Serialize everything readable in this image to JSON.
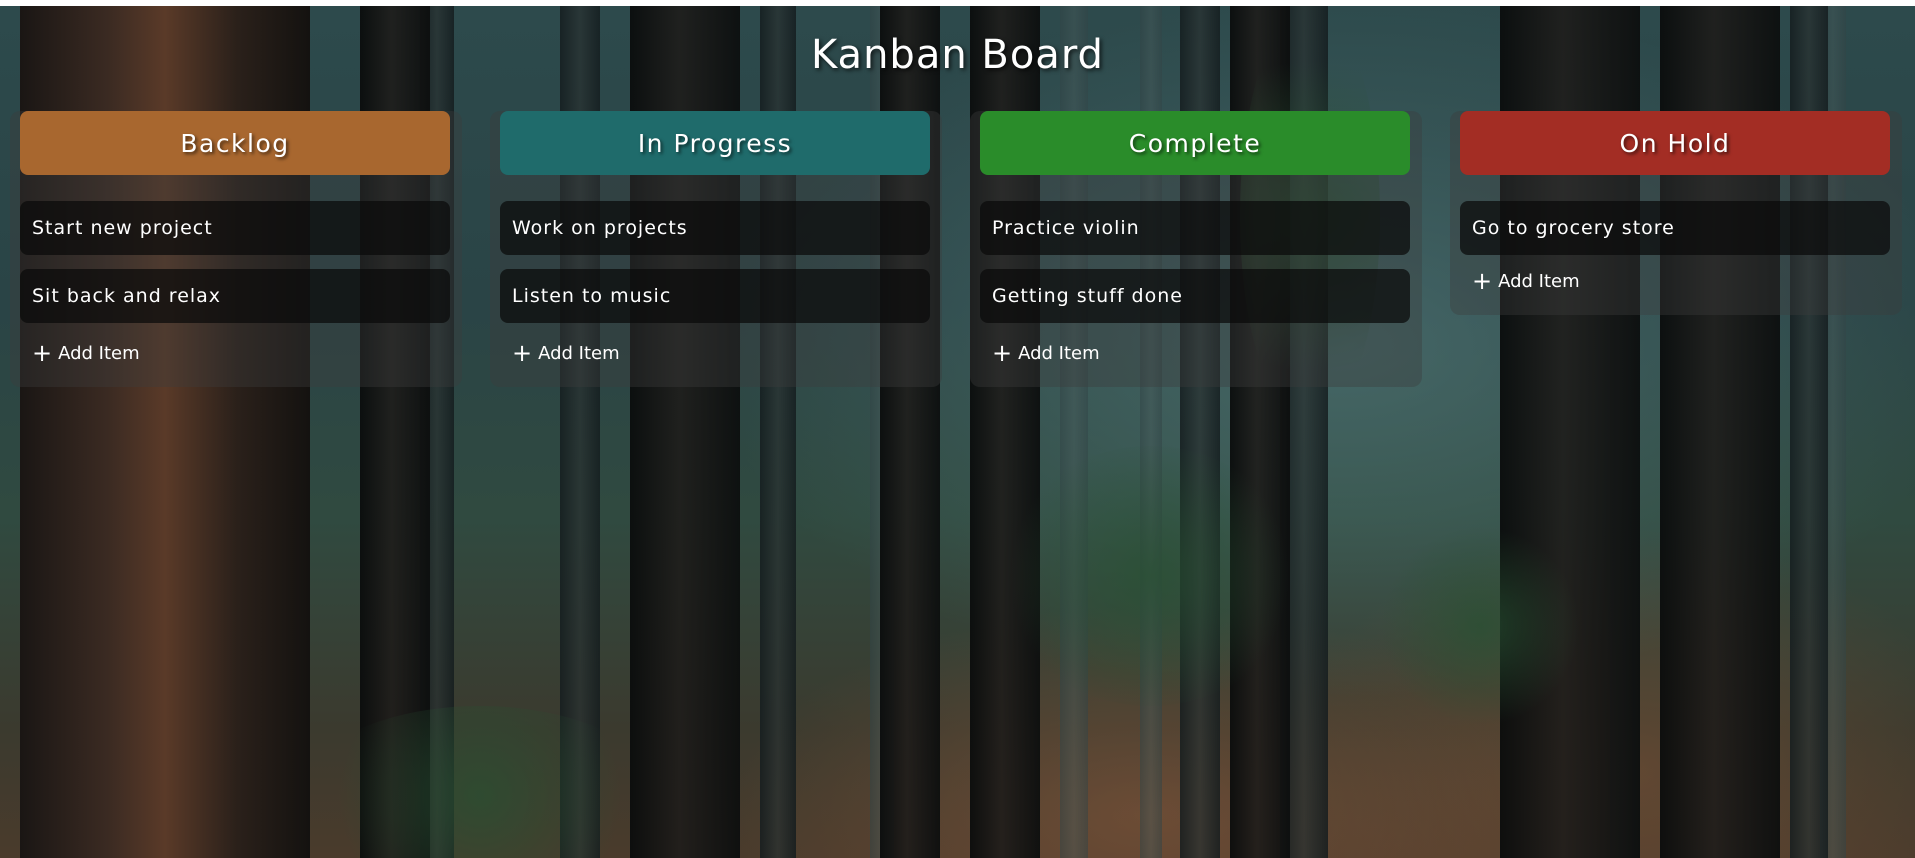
{
  "board": {
    "title": "Kanban Board"
  },
  "columns": [
    {
      "title": "Backlog",
      "color": "#a8672f",
      "items": [
        "Start new project",
        "Sit back and relax"
      ],
      "add_label": "Add Item"
    },
    {
      "title": "In Progress",
      "color": "#1f6b6b",
      "items": [
        "Work on projects",
        "Listen to music"
      ],
      "add_label": "Add Item"
    },
    {
      "title": "Complete",
      "color": "#2a8c2a",
      "items": [
        "Practice violin",
        "Getting stuff done"
      ],
      "add_label": "Add Item"
    },
    {
      "title": "On Hold",
      "color": "#a32d24",
      "items": [
        "Go to grocery store"
      ],
      "add_label": "Add Item"
    }
  ],
  "icons": {
    "add": "plus-icon"
  }
}
